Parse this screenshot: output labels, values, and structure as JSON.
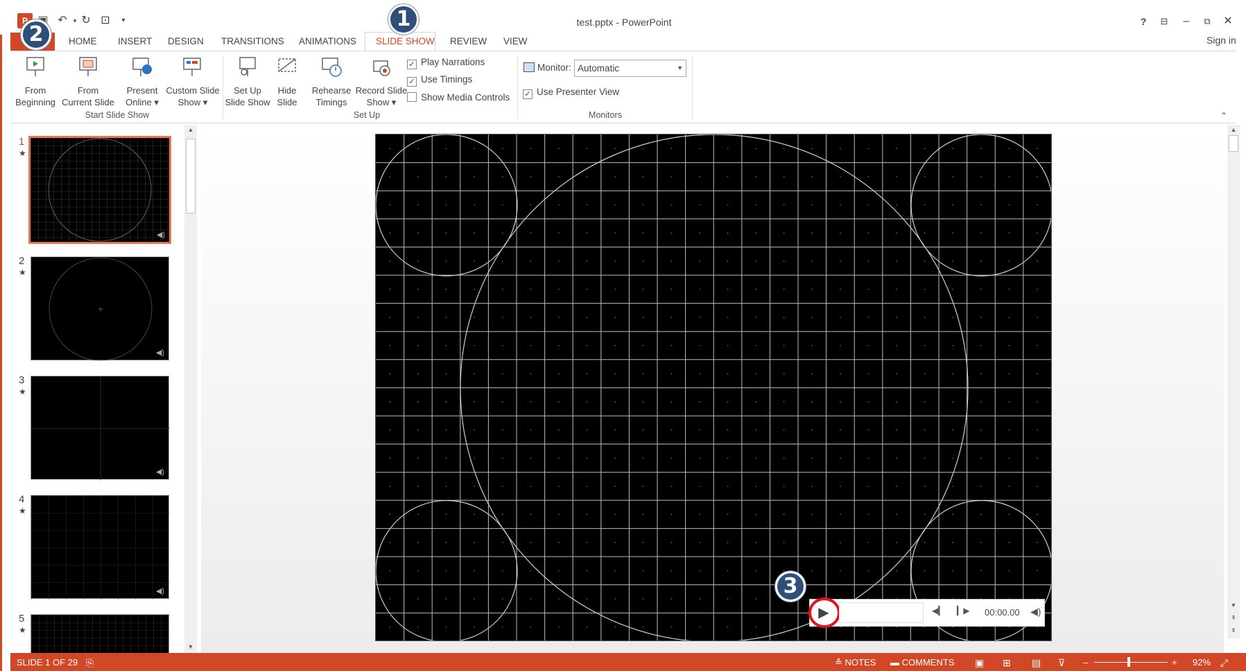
{
  "window": {
    "title": "test.pptx - PowerPoint",
    "help": "?",
    "sign_in": "Sign in"
  },
  "tabs": [
    "HOME",
    "INSERT",
    "DESIGN",
    "TRANSITIONS",
    "ANIMATIONS",
    "SLIDE SHOW",
    "REVIEW",
    "VIEW"
  ],
  "ribbon": {
    "start": {
      "from_beginning": [
        "From",
        "Beginning"
      ],
      "from_current": [
        "From",
        "Current Slide"
      ],
      "present_online": [
        "Present",
        "Online"
      ],
      "custom_show": [
        "Custom Slide",
        "Show"
      ],
      "label": "Start Slide Show"
    },
    "setup": {
      "set_up": [
        "Set Up",
        "Slide Show"
      ],
      "hide": [
        "Hide",
        "Slide"
      ],
      "rehearse": [
        "Rehearse",
        "Timings"
      ],
      "record": [
        "Record Slide",
        "Show"
      ],
      "play_narrations": "Play Narrations",
      "use_timings": "Use Timings",
      "show_media_controls": "Show Media Controls",
      "label": "Set Up"
    },
    "monitors": {
      "monitor_label": "Monitor:",
      "monitor_value": "Automatic",
      "use_presenter_view": "Use Presenter View",
      "label": "Monitors"
    }
  },
  "thumbnails": [
    {
      "num": "1",
      "star": "★"
    },
    {
      "num": "2",
      "star": "★"
    },
    {
      "num": "3",
      "star": "★"
    },
    {
      "num": "4",
      "star": "★"
    },
    {
      "num": "5",
      "star": "★"
    }
  ],
  "media": {
    "time": "00:00.00"
  },
  "callouts": [
    "1",
    "2",
    "3"
  ],
  "status": {
    "slide": "SLIDE 1 OF 29",
    "notes": "NOTES",
    "comments": "COMMENTS",
    "zoom": "92%"
  },
  "colors": {
    "accent": "#d24726",
    "callout": "#2f4f7a",
    "ring": "#e1141e"
  }
}
